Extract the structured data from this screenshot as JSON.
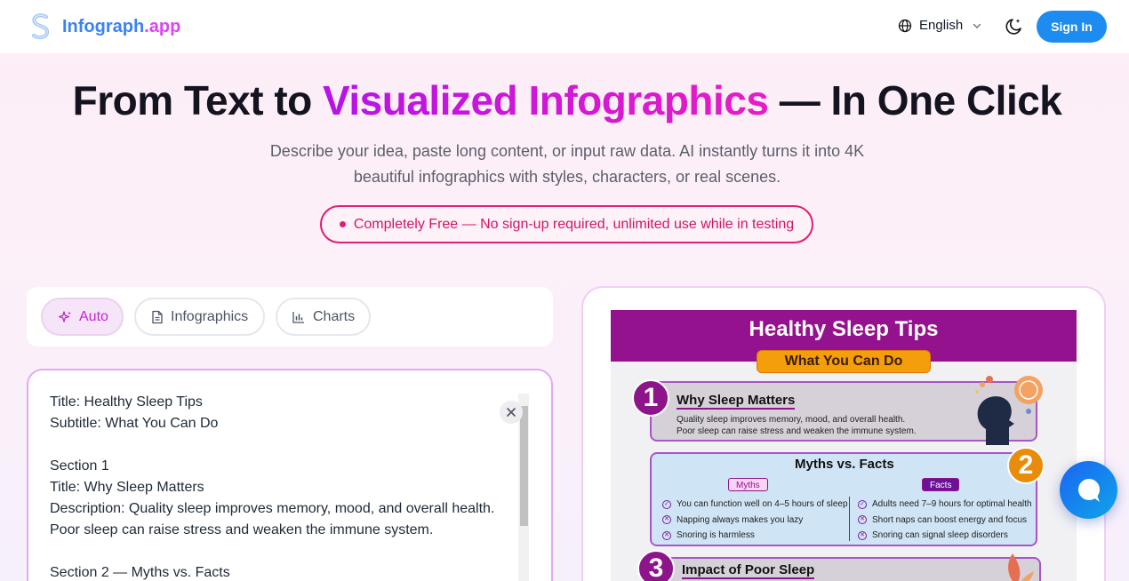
{
  "header": {
    "brand_main": "Infograph",
    "brand_suffix": ".app",
    "language": "English",
    "signin_label": "Sign In"
  },
  "hero": {
    "title_before": "From Text to ",
    "title_highlight": "Visualized Infographics",
    "title_after": " — In One Click",
    "subtitle": "Describe your idea, paste long content, or input raw data. AI instantly turns it into 4K beautiful infographics with styles, characters, or real scenes.",
    "badge": "Completely Free — No sign-up required, unlimited use while in testing"
  },
  "tabs": [
    {
      "label": "Auto",
      "icon": "sparkle-icon",
      "active": true
    },
    {
      "label": "Infographics",
      "icon": "document-icon",
      "active": false
    },
    {
      "label": "Charts",
      "icon": "bar-chart-icon",
      "active": false
    }
  ],
  "editor": {
    "content": "Title: Healthy Sleep Tips\nSubtitle: What You Can Do\n\nSection 1\nTitle: Why Sleep Matters\nDescription: Quality sleep improves memory, mood, and overall health.\nPoor sleep can raise stress and weaken the immune system.\n\nSection 2 — Myths vs. Facts"
  },
  "preview": {
    "title": "Healthy Sleep Tips",
    "subtitle": "What You Can Do",
    "section1": {
      "number": "1",
      "title": "Why Sleep Matters",
      "desc1": "Quality sleep improves memory, mood, and overall health.",
      "desc2": "Poor sleep can raise stress and weaken the immune system."
    },
    "section2": {
      "number": "2",
      "title": "Myths vs. Facts",
      "myths_label": "Myths",
      "facts_label": "Facts",
      "myths": [
        "You can function well on 4–5 hours of sleep",
        "Napping always makes you lazy",
        "Snoring is harmless"
      ],
      "facts": [
        "Adults need 7–9 hours for optimal health",
        "Short naps can boost energy and focus",
        "Snoring can signal sleep disorders"
      ]
    },
    "section3": {
      "number": "3",
      "title": "Impact of Poor Sleep"
    }
  },
  "colors": {
    "accent_blue": "#1d8cf0",
    "accent_magenta": "#d946ef",
    "badge_pink": "#e11d74",
    "poster_purple": "#95128e",
    "poster_orange": "#f59e0b"
  }
}
